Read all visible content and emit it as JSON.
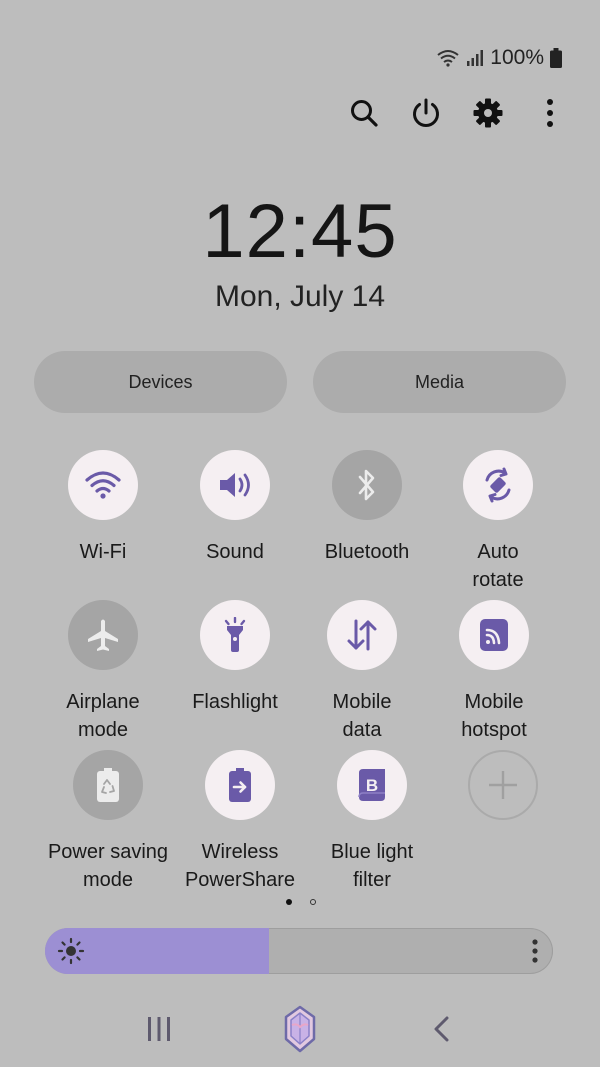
{
  "status": {
    "battery_text": "100%"
  },
  "clock": {
    "time": "12:45",
    "date": "Mon, July 14"
  },
  "pills": {
    "devices": "Devices",
    "media": "Media"
  },
  "tiles": [
    {
      "label1": "Wi-Fi",
      "label2": "",
      "state": "on",
      "icon": "wifi-icon"
    },
    {
      "label1": "Sound",
      "label2": "",
      "state": "on",
      "icon": "sound-icon"
    },
    {
      "label1": "Bluetooth",
      "label2": "",
      "state": "off",
      "icon": "bluetooth-icon"
    },
    {
      "label1": "Auto",
      "label2": "rotate",
      "state": "on",
      "icon": "auto-rotate-icon"
    },
    {
      "label1": "Airplane",
      "label2": "mode",
      "state": "off",
      "icon": "airplane-icon"
    },
    {
      "label1": "Flashlight",
      "label2": "",
      "state": "on",
      "icon": "flashlight-icon"
    },
    {
      "label1": "Mobile",
      "label2": "data",
      "state": "on",
      "icon": "mobile-data-icon"
    },
    {
      "label1": "Mobile",
      "label2": "hotspot",
      "state": "on",
      "icon": "hotspot-icon"
    },
    {
      "label1": "Power saving",
      "label2": "mode",
      "state": "off",
      "icon": "power-saving-icon"
    },
    {
      "label1": "Wireless",
      "label2": "PowerShare",
      "state": "on",
      "icon": "wireless-powershare-icon"
    },
    {
      "label1": "Blue light",
      "label2": "filter",
      "state": "on",
      "icon": "blue-light-filter-icon"
    }
  ],
  "pager": {
    "current": 1,
    "total": 2
  },
  "brightness": {
    "level": 0.44
  },
  "colors": {
    "accent": "#6a5aa8",
    "tile_on": "#f5eff2",
    "tile_off": "#a5a5a5",
    "slider_fill": "#9c8fd3",
    "background": "#bdbdbd"
  }
}
